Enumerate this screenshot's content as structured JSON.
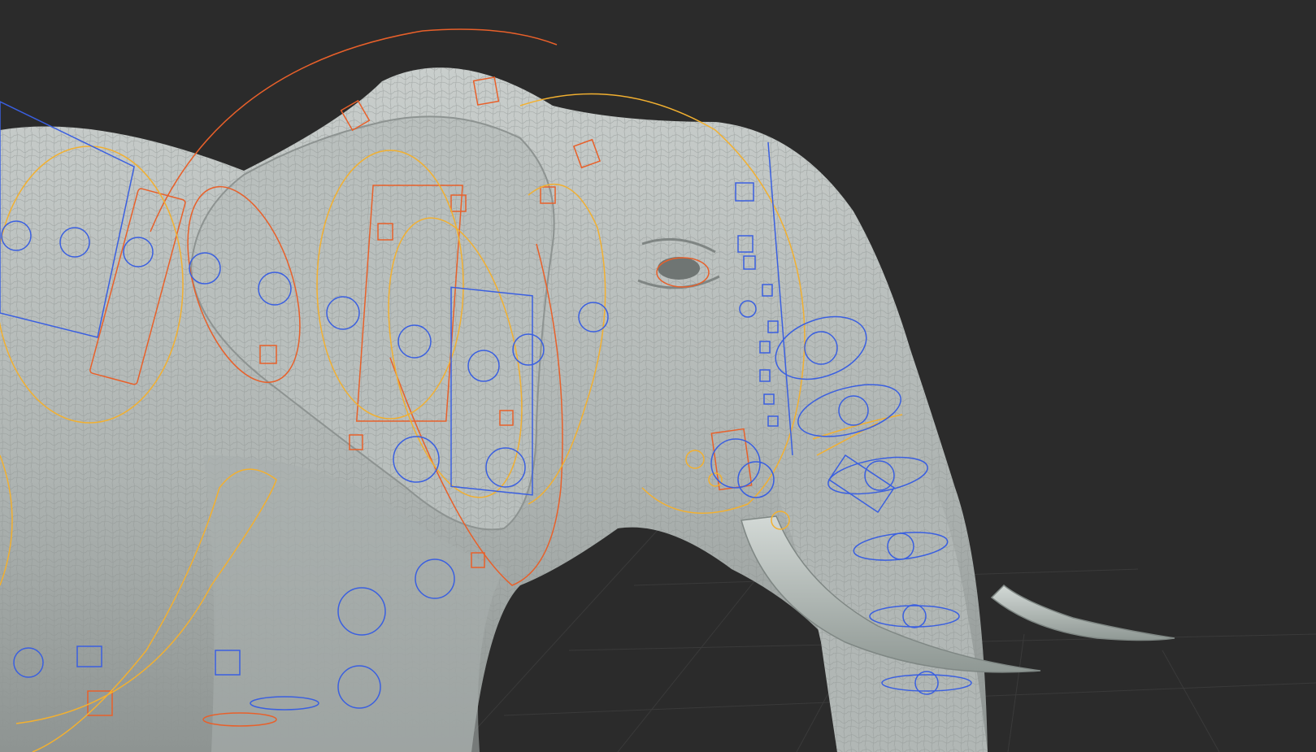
{
  "scene": {
    "colors": {
      "background": "#2b2b2b",
      "grid": "#3a3a3a",
      "skin_light": "#c4c9c7",
      "skin_mid": "#a9afad",
      "skin_dark": "#8d9391",
      "tusk_light": "#cfd6d3",
      "tusk_dark": "#8f9894",
      "control_blue": "#3a5fe0",
      "control_orange": "#e8602a",
      "control_yellow": "#f2b030"
    }
  }
}
